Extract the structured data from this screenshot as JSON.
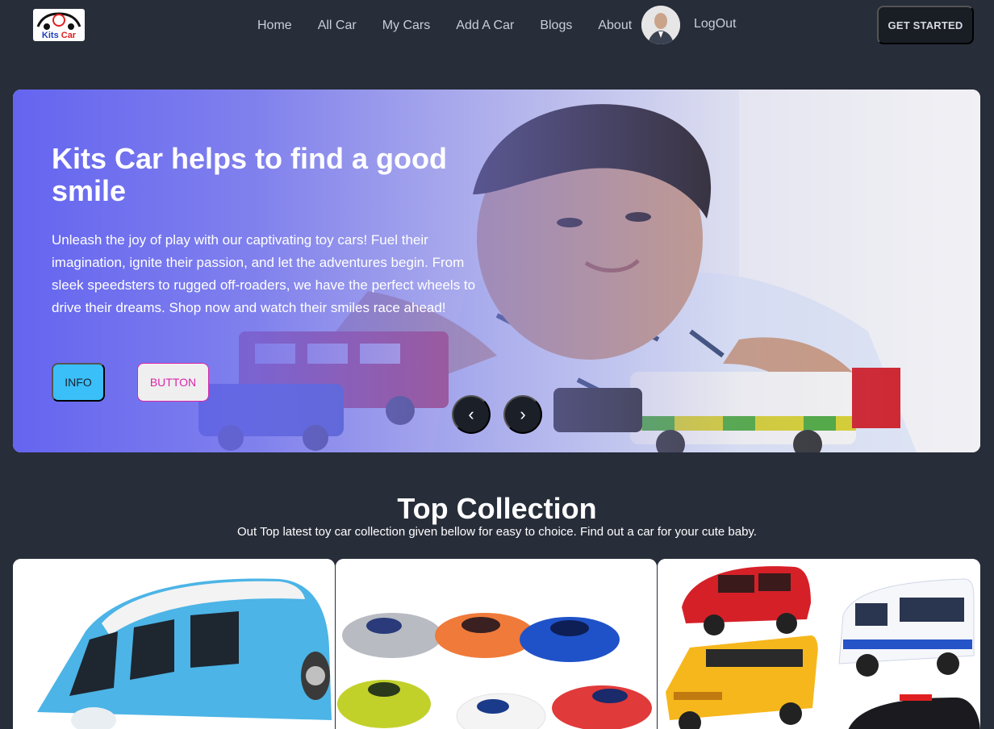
{
  "brand": {
    "logo_word1": "Kits",
    "logo_word2": "Car"
  },
  "nav": {
    "links": [
      "Home",
      "All Car",
      "My Cars",
      "Add A Car",
      "Blogs",
      "About"
    ],
    "logout": "LogOut",
    "cta": "GET STARTED"
  },
  "hero": {
    "title": "Kits Car helps to find a good smile",
    "description": "Unleash the joy of play with our captivating toy cars! Fuel their imagination, ignite their passion, and let the adventures begin. From sleek speedsters to rugged off-roaders, we have the perfect wheels to drive their dreams. Shop now and watch their smiles race ahead!",
    "info_button": "INFO",
    "secondary_button": "BUTTON",
    "prev_arrow": "‹",
    "next_arrow": "›"
  },
  "collection": {
    "title": "Top Collection",
    "subtitle": "Out Top latest toy car collection given bellow for easy to choice. Find out a car for your cute baby."
  },
  "colors": {
    "background": "#272d39",
    "hero_gradient": "#6060f0",
    "info_button": "#3abff8",
    "outline_button": "#d926a9"
  }
}
